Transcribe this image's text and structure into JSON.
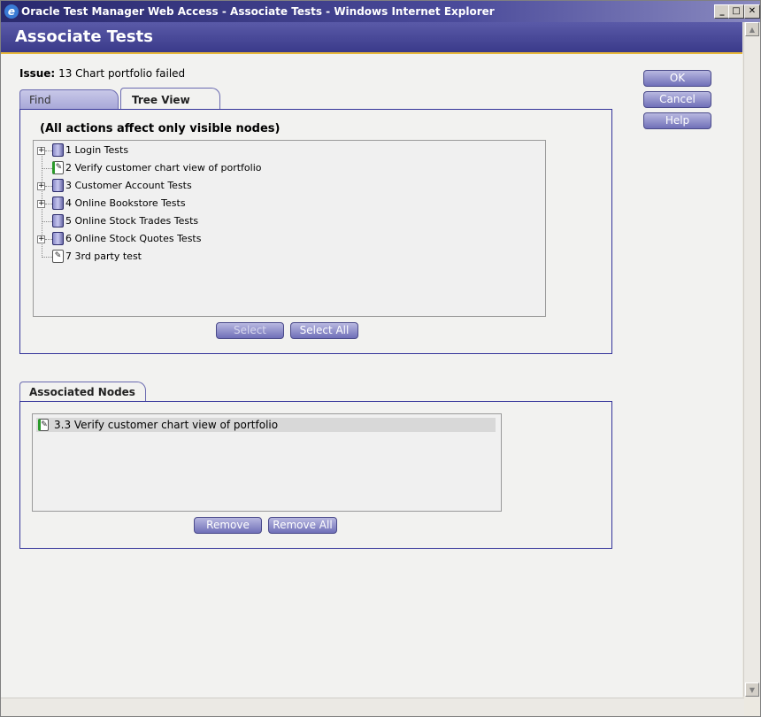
{
  "window": {
    "title": "Oracle Test Manager Web Access - Associate Tests - Windows Internet Explorer",
    "app_icon": "ie-icon",
    "controls": {
      "minimize": "_",
      "maximize": "□",
      "close": "✕"
    }
  },
  "header": {
    "title": "Associate Tests"
  },
  "issue": {
    "label": "Issue:",
    "value": "13 Chart portfolio failed"
  },
  "tabs": [
    {
      "label": "Find",
      "active": false
    },
    {
      "label": "Tree View",
      "active": true
    }
  ],
  "tree_panel": {
    "note": "(All actions affect only visible nodes)",
    "nodes": [
      {
        "label": "1 Login Tests",
        "expandable": true,
        "icon": "test-folder-icon"
      },
      {
        "label": "2 Verify customer chart view of portfolio",
        "expandable": false,
        "icon": "test-icon"
      },
      {
        "label": "3 Customer Account Tests",
        "expandable": true,
        "icon": "test-folder-icon"
      },
      {
        "label": "4 Online Bookstore Tests",
        "expandable": true,
        "icon": "test-folder-icon"
      },
      {
        "label": "5 Online Stock Trades Tests",
        "expandable": false,
        "icon": "test-folder-icon"
      },
      {
        "label": "6 Online Stock Quotes Tests",
        "expandable": true,
        "icon": "test-folder-icon"
      },
      {
        "label": "7 3rd party test",
        "expandable": false,
        "icon": "third-party-test-icon"
      }
    ],
    "buttons": {
      "select": "Select",
      "select_all": "Select All"
    }
  },
  "associated": {
    "tab_label": "Associated Nodes",
    "items": [
      {
        "label": "3.3 Verify customer chart view of portfolio",
        "icon": "test-icon"
      }
    ],
    "buttons": {
      "remove": "Remove",
      "remove_all": "Remove All"
    }
  },
  "side_buttons": {
    "ok": "OK",
    "cancel": "Cancel",
    "help": "Help"
  },
  "colors": {
    "accent": "#4a4a9a",
    "header_gold": "#e8b83a",
    "panel_border": "#34349a"
  }
}
